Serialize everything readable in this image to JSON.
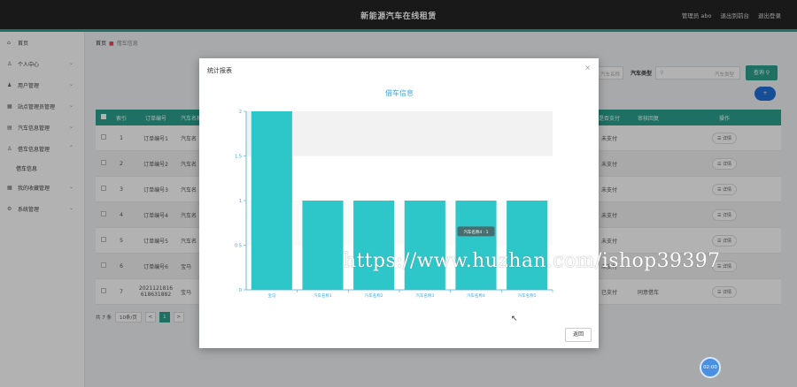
{
  "app": {
    "title": "新能源汽车在线租赁",
    "user_label": "管理员 abo",
    "backend_link": "退出到前台",
    "logout_link": "退出登录"
  },
  "sidebar": {
    "items": [
      {
        "label": "首页",
        "icon": "home-icon"
      },
      {
        "label": "个人中心",
        "icon": "user-icon"
      },
      {
        "label": "用户管理",
        "icon": "users-icon"
      },
      {
        "label": "站点管理员管理",
        "icon": "grid-icon"
      },
      {
        "label": "汽车信息管理",
        "icon": "car-icon"
      },
      {
        "label": "借车信息管理",
        "icon": "user-icon"
      },
      {
        "label": "借车信息",
        "icon": ""
      },
      {
        "label": "我的收藏管理",
        "icon": "grid-icon"
      },
      {
        "label": "系统管理",
        "icon": "settings-icon"
      }
    ]
  },
  "breadcrumb": {
    "home": "首页",
    "current": "借车信息"
  },
  "search": {
    "car_type_label": "汽车类型",
    "input1_placeholder": "汽车名称",
    "input2_placeholder": "汽车类型",
    "button": "查询"
  },
  "add_button": "+",
  "table": {
    "headers": [
      "索引",
      "订单编号",
      "汽车名称",
      "是否支付",
      "审核回复",
      "操作"
    ],
    "rows": [
      {
        "idx": "1",
        "order": "订单编号1",
        "car": "汽车名",
        "pay": "未支付",
        "audit": "",
        "op": "详情"
      },
      {
        "idx": "2",
        "order": "订单编号2",
        "car": "汽车名",
        "pay": "未支付",
        "audit": "",
        "op": "详情"
      },
      {
        "idx": "3",
        "order": "订单编号3",
        "car": "汽车名",
        "pay": "未支付",
        "audit": "",
        "op": "详情"
      },
      {
        "idx": "4",
        "order": "订单编号4",
        "car": "汽车名",
        "pay": "未支付",
        "audit": "",
        "op": "详情"
      },
      {
        "idx": "5",
        "order": "订单编号5",
        "car": "汽车名",
        "pay": "未支付",
        "audit": "",
        "op": "详情"
      },
      {
        "idx": "6",
        "order": "订单编号6",
        "car": "宝马",
        "pay": "未支付",
        "audit": "",
        "op": "详情"
      },
      {
        "idx": "7",
        "order": "2021121816 618631882",
        "car": "宝马",
        "pay": "已支付",
        "audit": "同意借车",
        "op": "详情"
      }
    ]
  },
  "pager": {
    "total": "共 7 条",
    "per_page": "10条/页",
    "prev": "<",
    "page": "1",
    "next": ">"
  },
  "modal": {
    "title": "统计报表",
    "close": "×",
    "back_button": "返回",
    "tooltip": "汽车名称4 : 1"
  },
  "chart_data": {
    "type": "bar",
    "title": "借车信息",
    "categories": [
      "宝马",
      "汽车名称1",
      "汽车名称2",
      "汽车名称3",
      "汽车名称4",
      "汽车名称5"
    ],
    "values": [
      2,
      1,
      1,
      1,
      1,
      1
    ],
    "ylim": [
      0,
      2
    ],
    "yticks": [
      "0",
      "0.5",
      "1",
      "1.5",
      "2"
    ],
    "bar_color": "#2ec7c9",
    "grid": true
  },
  "watermark": "https://www.huzhan.com/ishop39397",
  "clock": "02:00",
  "colors": {
    "accent": "#2aa18d",
    "topbar": "#242424"
  }
}
